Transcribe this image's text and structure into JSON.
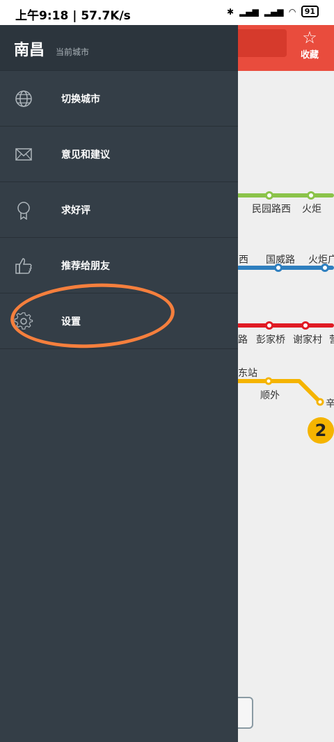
{
  "status_bar": {
    "time_speed": "上午9:18 | 57.7K/s",
    "battery": "91"
  },
  "app": {
    "favorite_label": "收藏"
  },
  "map": {
    "stations": [
      "民园路西",
      "火炬",
      "西",
      "国威路",
      "火炬广",
      "路",
      "彭家桥",
      "谢家村",
      "营",
      "东站",
      "顺外",
      "辛"
    ],
    "line_badge": "2"
  },
  "drawer": {
    "city": "南昌",
    "city_sub": "当前城市",
    "items": [
      {
        "label": "切换城市",
        "icon": "globe-icon"
      },
      {
        "label": "意见和建议",
        "icon": "mail-icon"
      },
      {
        "label": "求好评",
        "icon": "award-icon"
      },
      {
        "label": "推荐给朋友",
        "icon": "thumbs-up-icon"
      },
      {
        "label": "设置",
        "icon": "gear-icon"
      }
    ]
  },
  "colors": {
    "drawer_bg": "#343e47",
    "header_red": "#e94c3d",
    "highlight": "#f57f3d",
    "line_green": "#8bc34a",
    "line_blue": "#2e7fbf",
    "line_red": "#e01b24",
    "line_yellow": "#f5b400"
  }
}
